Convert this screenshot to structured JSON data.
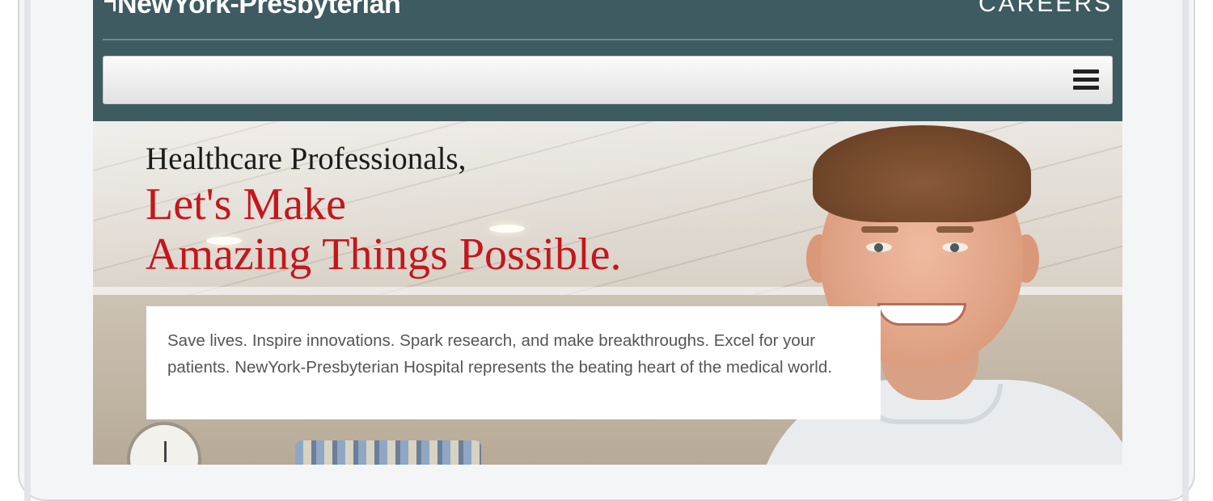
{
  "header": {
    "logo_text": "NewYork-Presbyterian",
    "section_label": "CAREERS"
  },
  "nav": {
    "menu_icon": "hamburger-menu-icon"
  },
  "hero": {
    "subtitle": "Healthcare Professionals,",
    "title_line1": "Let's Make",
    "title_line2": "Amazing Things Possible.",
    "body": "Save lives. Inspire innovations. Spark research, and make breakthroughs. Excel for your patients. NewYork-Presbyterian Hospital represents the beating heart of the medical world."
  },
  "colors": {
    "header_bg": "#3e5b61",
    "title_red": "#c4161c",
    "body_text": "#555555"
  }
}
